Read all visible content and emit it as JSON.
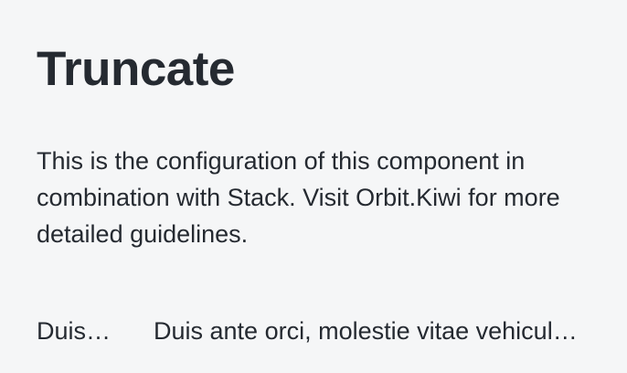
{
  "header": {
    "title": "Truncate"
  },
  "intro": {
    "description": "This is the configuration of this component in combination with Stack. Visit Orbit.Kiwi for more detailed guidelines."
  },
  "stack": {
    "items": [
      {
        "text": "Duis ante orci, molestie vitae vehicula venenatis, tincidunt ac pede."
      },
      {
        "text": "Duis ante orci, molestie vitae vehicula venenatis, tincidunt ac pede."
      }
    ]
  }
}
